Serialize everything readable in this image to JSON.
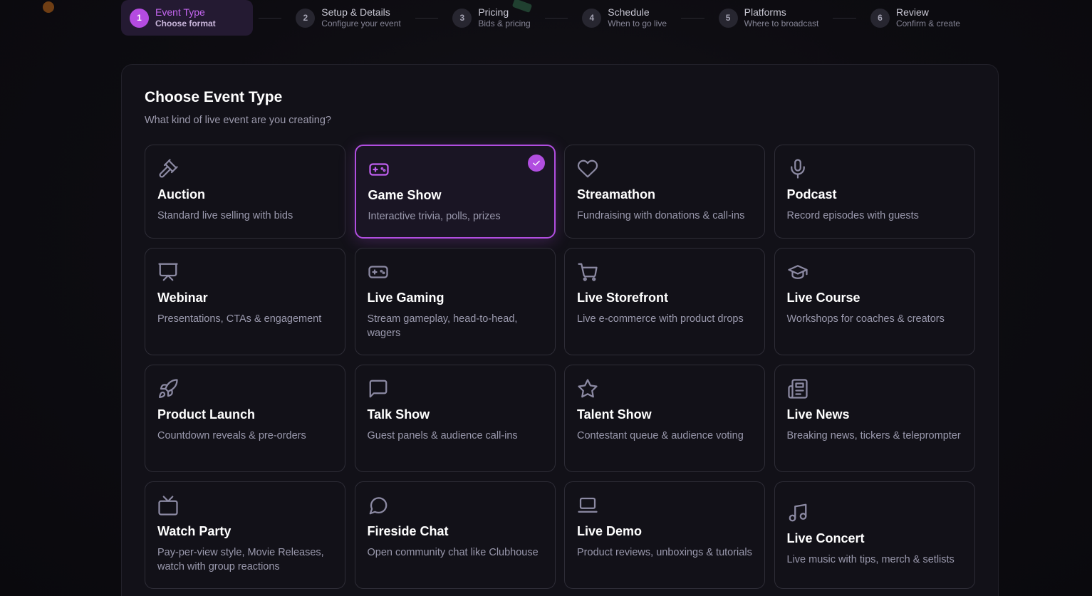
{
  "steps": [
    {
      "num": "1",
      "title": "Event Type",
      "sub": "Choose format",
      "active": true
    },
    {
      "num": "2",
      "title": "Setup & Details",
      "sub": "Configure your event"
    },
    {
      "num": "3",
      "title": "Pricing",
      "sub": "Bids & pricing"
    },
    {
      "num": "4",
      "title": "Schedule",
      "sub": "When to go live"
    },
    {
      "num": "5",
      "title": "Platforms",
      "sub": "Where to broadcast"
    },
    {
      "num": "6",
      "title": "Review",
      "sub": "Confirm & create"
    }
  ],
  "panel": {
    "title": "Choose Event Type",
    "subtitle": "What kind of live event are you creating?"
  },
  "cards": [
    {
      "icon": "gavel-icon",
      "title": "Auction",
      "desc": "Standard live selling with bids"
    },
    {
      "icon": "gamepad-icon",
      "title": "Game Show",
      "desc": "Interactive trivia, polls, prizes",
      "selected": true
    },
    {
      "icon": "heart-icon",
      "title": "Streamathon",
      "desc": "Fundraising with donations & call-ins"
    },
    {
      "icon": "microphone-icon",
      "title": "Podcast",
      "desc": "Record episodes with guests"
    },
    {
      "icon": "presentation-icon",
      "title": "Webinar",
      "desc": "Presentations, CTAs & engagement"
    },
    {
      "icon": "gamepad-icon",
      "title": "Live Gaming",
      "desc": "Stream gameplay, head-to-head, wagers"
    },
    {
      "icon": "cart-icon",
      "title": "Live Storefront",
      "desc": "Live e-commerce with product drops"
    },
    {
      "icon": "graduation-cap-icon",
      "title": "Live Course",
      "desc": "Workshops for coaches & creators"
    },
    {
      "icon": "rocket-icon",
      "title": "Product Launch",
      "desc": "Countdown reveals & pre-orders"
    },
    {
      "icon": "message-square-icon",
      "title": "Talk Show",
      "desc": "Guest panels & audience call-ins"
    },
    {
      "icon": "star-icon",
      "title": "Talent Show",
      "desc": "Contestant queue & audience voting"
    },
    {
      "icon": "newspaper-icon",
      "title": "Live News",
      "desc": "Breaking news, tickers & teleprompter"
    },
    {
      "icon": "tv-icon",
      "title": "Watch Party",
      "desc": "Pay-per-view style, Movie Releases, watch with group reactions"
    },
    {
      "icon": "message-circle-icon",
      "title": "Fireside Chat",
      "desc": "Open community chat like Clubhouse"
    },
    {
      "icon": "laptop-icon",
      "title": "Live Demo",
      "desc": "Product reviews, unboxings & tutorials"
    },
    {
      "icon": "music-icon",
      "title": "Live Concert",
      "desc": "Live music with tips, merch & setlists"
    }
  ],
  "colors": {
    "accent": "#b14ee0",
    "background": "#0d0c11",
    "panel": "#121118"
  }
}
